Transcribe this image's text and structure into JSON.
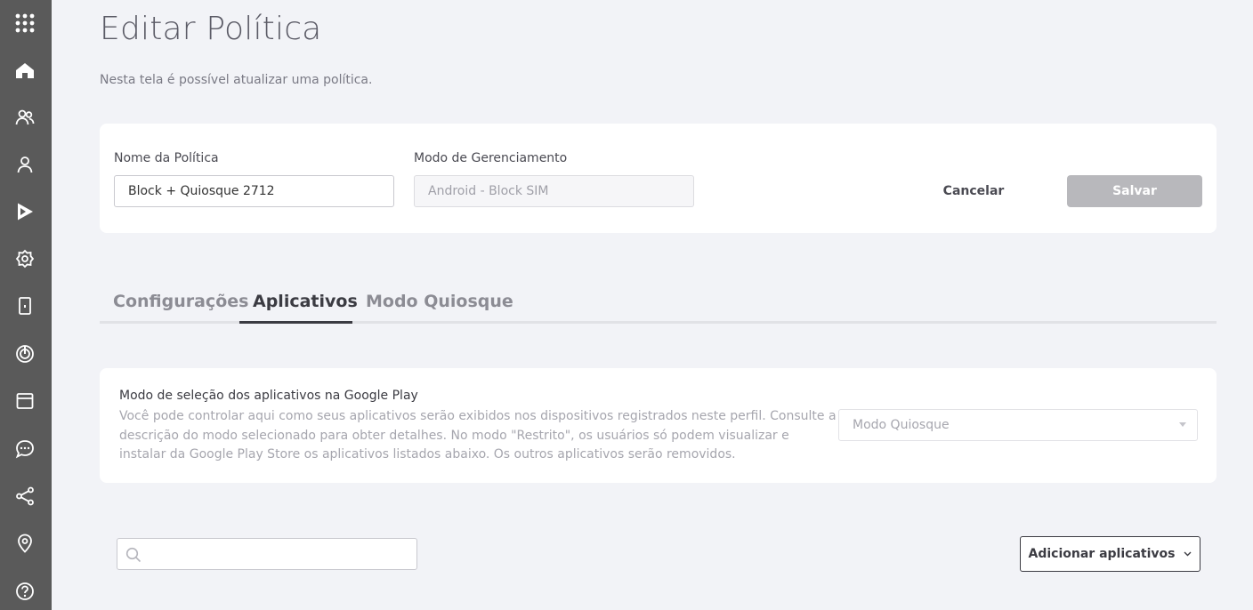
{
  "sidebar": {
    "icons": [
      "apps-grid-icon",
      "dashboard-icon",
      "users-group-icon",
      "user-icon",
      "play-store-icon",
      "settings-icon",
      "device-icon",
      "target-icon",
      "calendar-icon",
      "chat-icon",
      "share-icon",
      "location-icon",
      "help-icon"
    ],
    "color": "#5a5a5a"
  },
  "header": {
    "title": "Editar Política",
    "subtitle": "Nesta tela é possível atualizar uma política."
  },
  "policy_form": {
    "name_label": "Nome da Política",
    "name_value": "Block + Quiosque 2712",
    "mode_label": "Modo de Gerenciamento",
    "mode_value": "Android - Block SIM",
    "cancel_label": "Cancelar",
    "save_label": "Salvar"
  },
  "tabs": [
    {
      "label": "Configurações",
      "active": false
    },
    {
      "label": "Aplicativos",
      "active": true
    },
    {
      "label": "Modo Quiosque",
      "active": false
    }
  ],
  "app_mode": {
    "title": "Modo de seleção dos aplicativos na Google Play",
    "description": "Você pode controlar aqui como seus aplicativos serão exibidos nos dispositivos registrados neste perfil. Consulte a descrição do modo selecionado para obter detalhes. No modo \"Restrito\", os usuários só podem visualizar e instalar da Google Play Store os aplicativos listados abaixo. Os outros aplicativos serão removidos.",
    "select_value": "Modo Quiosque"
  },
  "apps": {
    "search_value": "",
    "add_button_label": "Adicionar aplicativos"
  }
}
